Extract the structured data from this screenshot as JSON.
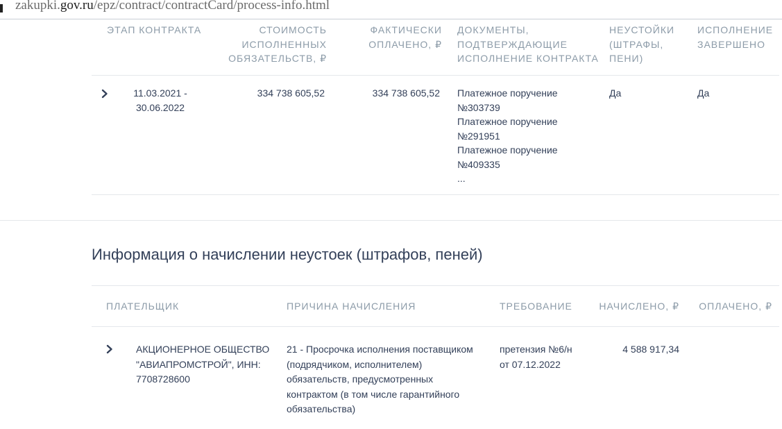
{
  "browser": {
    "url_prefix": "zakupki.",
    "url_host": "gov.ru",
    "url_path": "/epz/contract/contractCard/process-info.html"
  },
  "execution_table": {
    "headers": {
      "stage": [
        "ЭТАП КОНТРАКТА"
      ],
      "cost": [
        "СТОИМОСТЬ",
        "ИСПОЛНЕННЫХ",
        "ОБЯЗАТЕЛЬСТВ, ₽"
      ],
      "paid": [
        "ФАКТИЧЕСКИ",
        "ОПЛАЧЕНО, ₽"
      ],
      "documents": [
        "ДОКУМЕНТЫ,",
        "ПОДТВЕРЖДАЮЩИЕ",
        "ИСПОЛНЕНИЕ КОНТРАКТА"
      ],
      "penalties": [
        "НЕУСТОЙКИ",
        "(ШТРАФЫ,",
        "ПЕНИ)"
      ],
      "completed": [
        "ИСПОЛНЕНИЕ",
        "ЗАВЕРШЕНО"
      ]
    },
    "row": {
      "stage": [
        "11.03.2021 -",
        "30.06.2022"
      ],
      "cost": "334 738 605,52",
      "paid": "334 738 605,52",
      "documents": [
        "Платежное поручение",
        "№303739",
        "Платежное поручение",
        "№291951",
        "Платежное поручение",
        "№409335",
        "..."
      ],
      "penalties": "Да",
      "completed": "Да"
    }
  },
  "penalty_section": {
    "title": "Информация о начислении неустоек (штрафов, пеней)",
    "headers": {
      "payer": "ПЛАТЕЛЬЩИК",
      "reason": "ПРИЧИНА НАЧИСЛЕНИЯ",
      "demand": "ТРЕБОВАНИЕ",
      "accrued": "НАЧИСЛЕНО, ₽",
      "paid": "ОПЛАЧЕНО, ₽"
    },
    "row": {
      "payer": [
        "АКЦИОНЕРНОЕ ОБЩЕСТВО",
        "\"АВИАПРОМСТРОЙ\", ИНН:",
        "7708728600"
      ],
      "reason": [
        "21 - Просрочка исполнения поставщиком",
        "(подрядчиком, исполнителем)",
        "обязательств, предусмотренных",
        "контрактом (в том числе гарантийного",
        "обязательства)"
      ],
      "demand": [
        "претензия №6/н",
        "от 07.12.2022"
      ],
      "accrued": "4 588 917,34",
      "paid": ""
    }
  }
}
